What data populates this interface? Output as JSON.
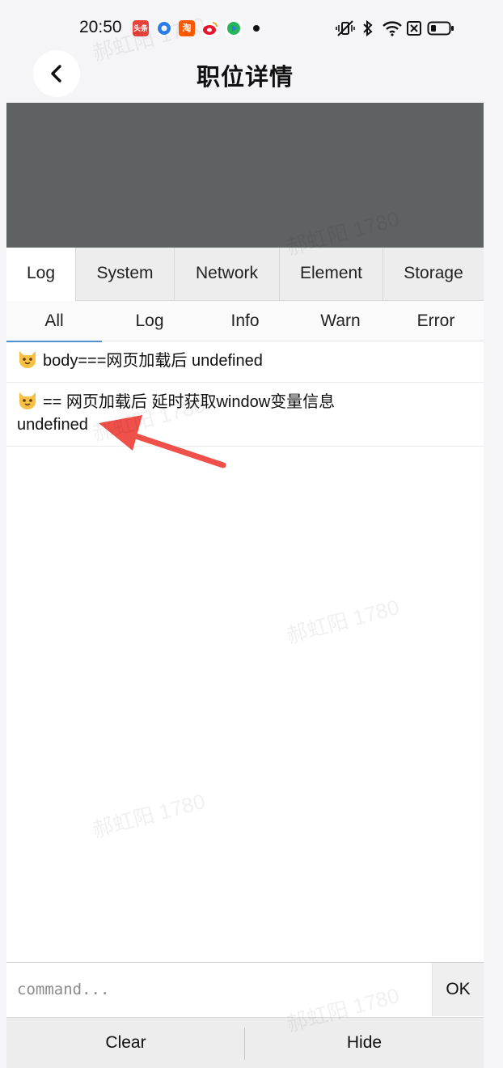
{
  "status_bar": {
    "time": "20:50",
    "apps": [
      {
        "icon": "toutiao-icon",
        "label": "头条",
        "color": "#e8403a"
      },
      {
        "icon": "browser-icon",
        "label": "",
        "color": "#2b7de9"
      },
      {
        "icon": "taobao-icon",
        "label": "淘",
        "color": "#ff5a00"
      },
      {
        "icon": "weibo-icon",
        "label": "",
        "color": "#f2a02a"
      },
      {
        "icon": "video-icon",
        "label": "",
        "color": "#27b55a"
      }
    ]
  },
  "header": {
    "title": "职位详情"
  },
  "tabs": [
    "Log",
    "System",
    "Network",
    "Element",
    "Storage"
  ],
  "active_tab": "Log",
  "subtabs": [
    "All",
    "Log",
    "Info",
    "Warn",
    "Error"
  ],
  "active_subtab": "All",
  "logs": [
    {
      "icon": "cat-icon",
      "text": "body===网页加载后 undefined"
    },
    {
      "icon": "cat-icon",
      "text": "== 网页加载后 延时获取window变量信息",
      "text2": "undefined"
    }
  ],
  "command": {
    "placeholder": "command...",
    "ok_label": "OK"
  },
  "footer": {
    "clear_label": "Clear",
    "hide_label": "Hide"
  },
  "watermark": "郝虹阳 1780",
  "colors": {
    "overlay": "#5f6263",
    "active_underline": "#4f8fd6",
    "annotation_arrow": "#f0504a"
  }
}
